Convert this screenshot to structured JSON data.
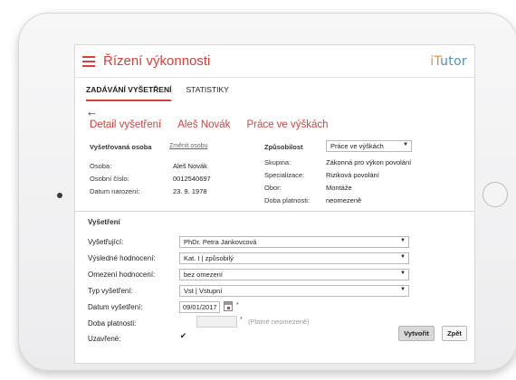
{
  "header": {
    "title": "Řízení výkonnosti",
    "logo_part1": "iT",
    "logo_part2": "utor"
  },
  "tabs": [
    {
      "label": "ZADÁVÁNÍ VYŠETŘENÍ"
    },
    {
      "label": "STATISTIKY"
    }
  ],
  "breadcrumb": {
    "back": "←",
    "items": [
      "Detail vyšetření",
      "Aleš Novák",
      "Práce ve výškách"
    ]
  },
  "person": {
    "heading": "Vyšetřovaná osoba",
    "change_link": "Změnit osobu",
    "fields": [
      {
        "label": "Osoba:",
        "value": "Aleš Novák"
      },
      {
        "label": "Osobní číslo:",
        "value": "0012540697"
      },
      {
        "label": "Datum narození:",
        "value": "23. 9. 1978"
      }
    ]
  },
  "competency": {
    "heading": "Způsobilost",
    "selected": "Práce ve výškách",
    "caret": "▼",
    "fields": [
      {
        "label": "Skupina:",
        "value": "Zákonná pro výkon povolání"
      },
      {
        "label": "Specializace:",
        "value": "Riziková povolání"
      },
      {
        "label": "Obor:",
        "value": "Montáže"
      },
      {
        "label": "Doba platnosti:",
        "value": "neomezeně"
      }
    ]
  },
  "exam": {
    "heading": "Vyšetření",
    "fields": [
      {
        "label": "Vyšetřující:",
        "value": "PhDr. Petra Jankovcová"
      },
      {
        "label": "Výsledné hodnocení:",
        "value": "Kat. I | způsobilý"
      },
      {
        "label": "Omezení hodnocení:",
        "value": "bez omezení"
      },
      {
        "label": "Typ vyšetření:",
        "value": "Vst | Vstupní"
      }
    ],
    "date_label": "Datum vyšetření:",
    "date_value": "09/01/2017",
    "validity_label": "Doba platnosti:",
    "validity_hint": "(Platné neomezeně)",
    "closed_label": "Uzavřené:",
    "closed_check": "✔",
    "required_mark": "*"
  },
  "buttons": {
    "create": "Vytvořit",
    "back": "Zpět"
  }
}
